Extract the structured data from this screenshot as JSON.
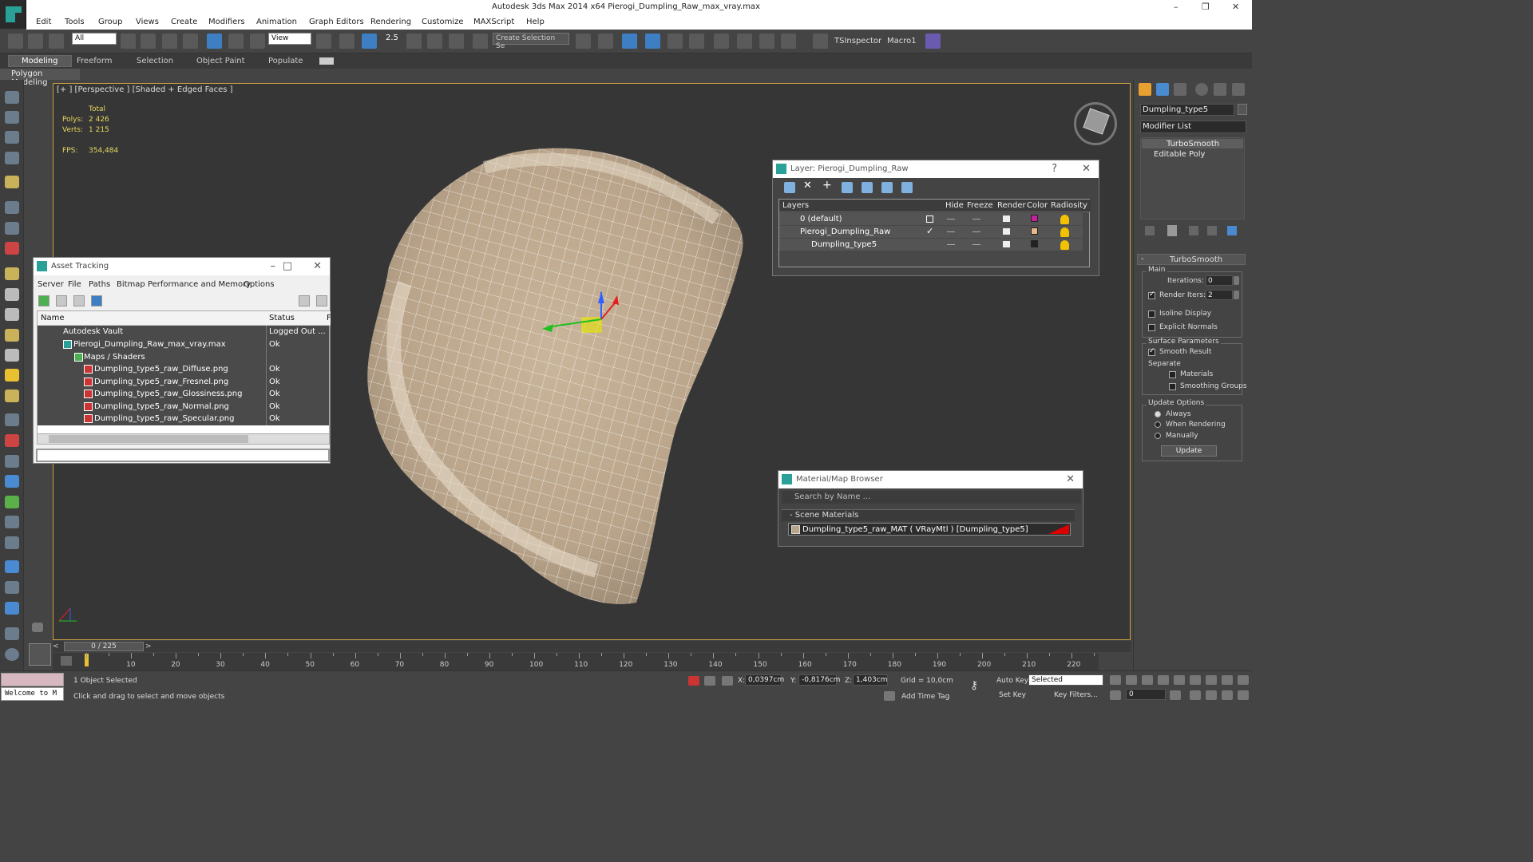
{
  "app": {
    "title": "Autodesk 3ds Max  2014 x64    Pierogi_Dumpling_Raw_max_vray.max",
    "window_controls": [
      "–",
      "❐",
      "✕"
    ]
  },
  "menu": [
    "Edit",
    "Tools",
    "Group",
    "Views",
    "Create",
    "Modifiers",
    "Animation",
    "Graph Editors",
    "Rendering",
    "Customize",
    "MAXScript",
    "Help"
  ],
  "toolbar": {
    "selection_filter": "All",
    "ref_coord": "View",
    "snap_label": "2.5",
    "named_sets": "Create Selection Se",
    "tsinspector": "TSInspector",
    "macro": "Macro1"
  },
  "ribbon": {
    "tabs": [
      "Modeling",
      "Freeform",
      "Selection",
      "Object Paint",
      "Populate"
    ],
    "sub": "Polygon Modeling"
  },
  "viewport": {
    "label": "[+ ] [Perspective ] [Shaded + Edged Faces ]",
    "stats": {
      "total": "Total",
      "polys_label": "Polys:",
      "polys": "2 426",
      "verts_label": "Verts:",
      "verts": "1 215",
      "fps_label": "FPS:",
      "fps": "354,484"
    }
  },
  "asset_tracking": {
    "title": "Asset Tracking",
    "menu": [
      "Server",
      "File",
      "Paths",
      "Bitmap Performance and Memory",
      "Options"
    ],
    "columns": [
      "Name",
      "Status",
      "F"
    ],
    "rows": [
      {
        "name": "Autodesk Vault",
        "status": "Logged Out ..."
      },
      {
        "name": "Pierogi_Dumpling_Raw_max_vray.max",
        "status": "Ok"
      },
      {
        "name": "Maps / Shaders",
        "status": ""
      },
      {
        "name": "Dumpling_type5_raw_Diffuse.png",
        "status": "Ok"
      },
      {
        "name": "Dumpling_type5_raw_Fresnel.png",
        "status": "Ok"
      },
      {
        "name": "Dumpling_type5_raw_Glossiness.png",
        "status": "Ok"
      },
      {
        "name": "Dumpling_type5_raw_Normal.png",
        "status": "Ok"
      },
      {
        "name": "Dumpling_type5_raw_Specular.png",
        "status": "Ok"
      }
    ]
  },
  "layer_manager": {
    "title": "Layer: Pierogi_Dumpling_Raw",
    "help": "?",
    "columns": [
      "Layers",
      "Hide",
      "Freeze",
      "Render",
      "Color",
      "Radiosity"
    ],
    "rows": [
      {
        "name": "0 (default)",
        "color": "#c81ea0"
      },
      {
        "name": "Pierogi_Dumpling_Raw",
        "color": "#e8b88a"
      },
      {
        "name": "Dumpling_type5",
        "color": "#222222"
      }
    ]
  },
  "material_browser": {
    "title": "Material/Map Browser",
    "search_placeholder": "Search by Name ...",
    "section": "- Scene Materials",
    "material": "Dumpling_type5_raw_MAT  ( VRayMtl )  [Dumpling_type5]"
  },
  "command_panel": {
    "object_name": "Dumpling_type5",
    "modifier_list": "Modifier List",
    "stack": [
      "TurboSmooth",
      "Editable Poly"
    ],
    "rollout_title": "TurboSmooth",
    "main_label": "Main",
    "iterations_label": "Iterations:",
    "iterations": "0",
    "render_iters_label": "Render Iters:",
    "render_iters": "2",
    "isoline": "Isoline Display",
    "explicit_normals": "Explicit Normals",
    "surface_params": "Surface Parameters",
    "smooth_result": "Smooth Result",
    "separate": "Separate",
    "materials": "Materials",
    "smoothing_groups": "Smoothing Groups",
    "update_options": "Update Options",
    "always": "Always",
    "when_rendering": "When Rendering",
    "manually": "Manually",
    "update_btn": "Update"
  },
  "timeline": {
    "slider": "0 / 225",
    "ticks": [
      "10",
      "20",
      "30",
      "40",
      "50",
      "60",
      "70",
      "80",
      "90",
      "100",
      "110",
      "120",
      "130",
      "140",
      "150",
      "160",
      "170",
      "180",
      "190",
      "200",
      "210",
      "220"
    ]
  },
  "status": {
    "maxscript": "Welcome to M",
    "selected": "1 Object Selected",
    "prompt": "Click and drag to select and move objects",
    "x_label": "X:",
    "x": "0,0397cm",
    "y_label": "Y:",
    "y": "-0,8176cm",
    "z_label": "Z:",
    "z": "1,403cm",
    "grid": "Grid = 10,0cm",
    "add_time_tag": "Add Time Tag",
    "auto_key": "Auto Key",
    "set_key": "Set Key",
    "selected_set": "Selected",
    "key_filters": "Key Filters...",
    "frame": "0"
  }
}
